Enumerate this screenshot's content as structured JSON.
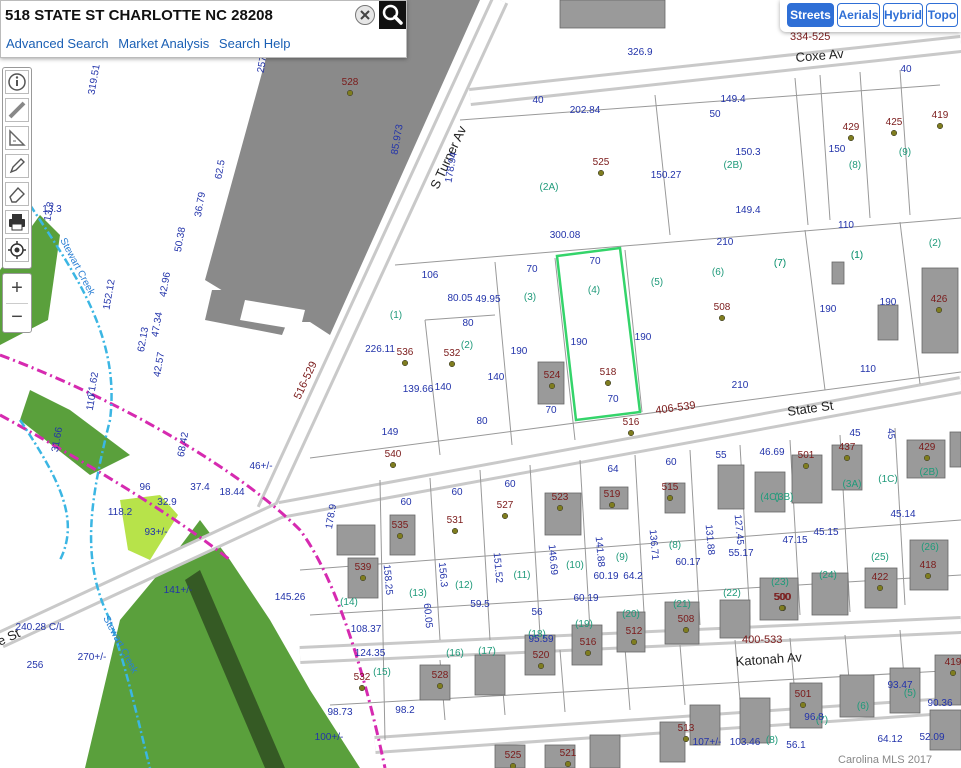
{
  "search": {
    "value": "518 STATE ST CHARLOTTE NC 28208",
    "links": [
      "Advanced Search",
      "Market Analysis",
      "Search Help"
    ]
  },
  "map_types": [
    {
      "label": "Streets",
      "active": true
    },
    {
      "label": "Aerials",
      "active": false
    },
    {
      "label": "Hybrid",
      "active": false
    },
    {
      "label": "Topo",
      "active": false
    }
  ],
  "tools": [
    "info-icon",
    "measure-distance-icon",
    "measure-area-icon",
    "draw-pencil-icon",
    "eraser-icon",
    "print-icon",
    "locate-icon"
  ],
  "zoom": {
    "in": "+",
    "out": "−"
  },
  "streets": {
    "s_turner": "S Turner Av",
    "coxe": "Coxe Av",
    "state": "State St",
    "katonah": "Katonah Av",
    "stewart_creek_1": "Stewart Creek",
    "stewart_creek_2": "Stewart Creek",
    "state_partial": "e St",
    "state_range": "406-539",
    "turner_range": "516-529",
    "katonah_range": "400-533",
    "coxe_range": "334-525"
  },
  "selected_parcel": "518",
  "address_numbers": [
    "528",
    "525",
    "429",
    "425",
    "419",
    "426",
    "536",
    "532",
    "524",
    "518",
    "508",
    "516",
    "540",
    "437",
    "501",
    "429",
    "527",
    "523",
    "519",
    "515",
    "535",
    "531",
    "539",
    "422",
    "418",
    "500",
    "508",
    "516",
    "520",
    "512",
    "528",
    "532",
    "501",
    "513",
    "521",
    "525",
    "419",
    "500"
  ],
  "lot_numbers": [
    "(1)",
    "(2A)",
    "(2B)",
    "(7)",
    "(8)",
    "(9)",
    "(1)",
    "(2)",
    "(3)",
    "(4)",
    "(5)",
    "(6)",
    "(7)",
    "(1)",
    "(2)",
    "(1C)",
    "(3A)",
    "(2B)",
    "(14)",
    "(13)",
    "(12)",
    "(11)",
    "(10)",
    "(9)",
    "(8)",
    "(25)",
    "(26)",
    "(24)",
    "(23)",
    "(22)",
    "(21)",
    "(20)",
    "(19)",
    "(18)",
    "(17)",
    "(16)",
    "(15)",
    "(3B)",
    "(4C)",
    "(5)",
    "(6)",
    "(7)",
    "(8)"
  ],
  "dimensions": [
    "326.9",
    "202.84",
    "149.4",
    "149.4",
    "300.08",
    "210",
    "210",
    "110",
    "110",
    "106",
    "80.05",
    "49.95",
    "70",
    "70",
    "70",
    "70",
    "190",
    "190",
    "190",
    "190",
    "190",
    "139.66",
    "140",
    "140",
    "80",
    "80",
    "149",
    "226.11",
    "178.94",
    "178.9",
    "85.973",
    "319.51",
    "257",
    "62.5",
    "36.79",
    "50.38",
    "42.96",
    "47.34",
    "42.57",
    "62.13",
    "68.42",
    "71.62",
    "110",
    "31.66",
    "152.12",
    "13.3",
    "96",
    "32.9",
    "118.2",
    "93+/-",
    "18.44",
    "37.4",
    "46+/-",
    "60",
    "60",
    "60",
    "64",
    "60",
    "55",
    "46.69",
    "45",
    "45",
    "158.25",
    "156.3",
    "151.52",
    "146.69",
    "141.88",
    "136.71",
    "131.88",
    "127.45",
    "60.05",
    "59.5",
    "60.19",
    "60.19",
    "64.2",
    "60.17",
    "55.17",
    "47.15",
    "45.15",
    "45.14",
    "108.37",
    "124.35",
    "56",
    "95.59",
    "98.2",
    "240.28 C/L",
    "141+/-",
    "145.26",
    "256",
    "270+/-",
    "98.73",
    "100+/-",
    "93.47",
    "90.36",
    "64.12",
    "56.1",
    "96.8",
    "103.46",
    "107+/-",
    "52.09",
    "40",
    "50",
    "40",
    "150",
    "150.27",
    "150.3",
    "13.3"
  ],
  "copyright": "Carolina MLS 2017"
}
